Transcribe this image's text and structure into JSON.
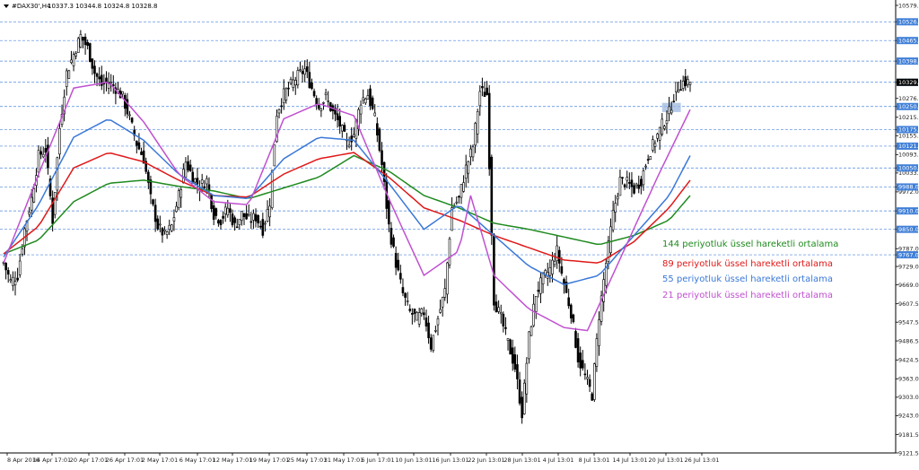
{
  "window": {
    "symbol_title": "#DAX30',H4",
    "ohlc": "10337.3 10344.8 10324.8 10328.8",
    "menu_icon": "triangle-down-icon"
  },
  "chart_data": {
    "type": "candlestick",
    "grid": false,
    "ylim": [
      9121.5,
      10579.5
    ],
    "y_ticks": [
      "10579.5",
      "10526.0",
      "10465.0",
      "10398.0",
      "10329.0",
      "10276.5",
      "10250.0",
      "10215.0",
      "10175.0",
      "10155.0",
      "10121.0",
      "10093.5",
      "10050.0",
      "10033.5",
      "9988.0",
      "9972.0",
      "9910.0",
      "9850.0",
      "9787.0",
      "9767.0",
      "9729.0",
      "9669.0",
      "9607.5",
      "9547.5",
      "9486.5",
      "9424.5",
      "9363.0",
      "9303.0",
      "9243.0",
      "9181.5",
      "9121.5"
    ],
    "x_ticks": [
      "8 Apr 2016",
      "14 Apr 17:01",
      "20 Apr 17:01",
      "26 Apr 17:01",
      "2 May 17:01",
      "6 May 17:01",
      "12 May 17:01",
      "19 May 17:01",
      "25 May 17:01",
      "31 May 17:01",
      "6 Jun 17:01",
      "10 Jun 13:01",
      "16 Jun 13:01",
      "22 Jun 13:01",
      "28 Jun 13:01",
      "4 Jul 13:01",
      "8 Jul 13:01",
      "14 Jul 13:01",
      "20 Jul 13:01",
      "26 Jul 13:01"
    ],
    "current_price": 10329.0,
    "horizontal_lines": [
      {
        "value": 10526.0,
        "label": "10526.0",
        "color": "#2c6fd6"
      },
      {
        "value": 10465.0,
        "label": "10465.0",
        "color": "#2c6fd6"
      },
      {
        "value": 10398.0,
        "label": "10398.0",
        "color": "#2c6fd6"
      },
      {
        "value": 10329.0,
        "label": "10329.0",
        "color": "#2c6fd6"
      },
      {
        "value": 10250.0,
        "label": "10250.0",
        "color": "#2c6fd6"
      },
      {
        "value": 10175.0,
        "label": "10175.0",
        "color": "#2c6fd6"
      },
      {
        "value": 10121.0,
        "label": "10121.0",
        "color": "#2c6fd6"
      },
      {
        "value": 10050.0,
        "label": "10050.0",
        "color": "#2c6fd6"
      },
      {
        "value": 9988.0,
        "label": "9988.0",
        "color": "#2c6fd6"
      },
      {
        "value": 9910.0,
        "label": "9910.0",
        "color": "#2c6fd6"
      },
      {
        "value": 9850.0,
        "label": "9850.0",
        "color": "#2c6fd6"
      },
      {
        "value": 9767.0,
        "label": "9767.0",
        "color": "#2c6fd6"
      }
    ],
    "highlight_box": {
      "x_from": 282,
      "x_to": 290,
      "y_from": 10232,
      "y_to": 10262,
      "color": "#9cb8e0"
    },
    "close_path": [
      [
        0,
        9740
      ],
      [
        3,
        9680
      ],
      [
        6,
        9700
      ],
      [
        9,
        9850
      ],
      [
        12,
        9950
      ],
      [
        15,
        10090
      ],
      [
        18,
        10110
      ],
      [
        21,
        9880
      ],
      [
        24,
        10180
      ],
      [
        27,
        10360
      ],
      [
        30,
        10420
      ],
      [
        33,
        10480
      ],
      [
        36,
        10440
      ],
      [
        39,
        10360
      ],
      [
        42,
        10320
      ],
      [
        45,
        10330
      ],
      [
        48,
        10310
      ],
      [
        51,
        10280
      ],
      [
        54,
        10210
      ],
      [
        57,
        10130
      ],
      [
        60,
        10080
      ],
      [
        63,
        9950
      ],
      [
        66,
        9860
      ],
      [
        69,
        9830
      ],
      [
        72,
        9860
      ],
      [
        75,
        9960
      ],
      [
        78,
        10070
      ],
      [
        81,
        10020
      ],
      [
        84,
        9990
      ],
      [
        87,
        10010
      ],
      [
        90,
        9900
      ],
      [
        93,
        9880
      ],
      [
        96,
        9920
      ],
      [
        99,
        9860
      ],
      [
        102,
        9900
      ],
      [
        105,
        9880
      ],
      [
        108,
        9890
      ],
      [
        111,
        9850
      ],
      [
        114,
        9940
      ],
      [
        117,
        10230
      ],
      [
        120,
        10290
      ],
      [
        123,
        10320
      ],
      [
        126,
        10350
      ],
      [
        129,
        10370
      ],
      [
        132,
        10310
      ],
      [
        135,
        10250
      ],
      [
        138,
        10280
      ],
      [
        141,
        10230
      ],
      [
        144,
        10190
      ],
      [
        147,
        10130
      ],
      [
        150,
        10160
      ],
      [
        153,
        10270
      ],
      [
        156,
        10290
      ],
      [
        159,
        10210
      ],
      [
        162,
        10060
      ],
      [
        165,
        9860
      ],
      [
        168,
        9740
      ],
      [
        171,
        9640
      ],
      [
        174,
        9580
      ],
      [
        177,
        9560
      ],
      [
        180,
        9580
      ],
      [
        183,
        9470
      ],
      [
        186,
        9560
      ],
      [
        189,
        9650
      ],
      [
        192,
        9920
      ],
      [
        195,
        9950
      ],
      [
        198,
        10050
      ],
      [
        201,
        10120
      ],
      [
        204,
        10300
      ],
      [
        207,
        10290
      ],
      [
        210,
        9620
      ],
      [
        213,
        9560
      ],
      [
        216,
        9480
      ],
      [
        219,
        9400
      ],
      [
        222,
        9250
      ],
      [
        225,
        9500
      ],
      [
        228,
        9640
      ],
      [
        231,
        9690
      ],
      [
        234,
        9720
      ],
      [
        237,
        9780
      ],
      [
        240,
        9670
      ],
      [
        243,
        9580
      ],
      [
        246,
        9430
      ],
      [
        249,
        9370
      ],
      [
        252,
        9310
      ],
      [
        255,
        9570
      ],
      [
        258,
        9740
      ],
      [
        261,
        9900
      ],
      [
        264,
        10010
      ],
      [
        267,
        10000
      ],
      [
        270,
        9980
      ],
      [
        273,
        10010
      ],
      [
        276,
        10090
      ],
      [
        279,
        10140
      ],
      [
        282,
        10190
      ],
      [
        285,
        10230
      ],
      [
        288,
        10310
      ],
      [
        291,
        10330
      ],
      [
        294,
        10329
      ]
    ],
    "series": [
      {
        "name": "144 periyotluk üssel hareketli ortalama",
        "color": "#1f8a1f",
        "values": [
          [
            0,
            9770
          ],
          [
            15,
            9815
          ],
          [
            30,
            9940
          ],
          [
            45,
            10000
          ],
          [
            60,
            10010
          ],
          [
            75,
            9990
          ],
          [
            90,
            9975
          ],
          [
            105,
            9950
          ],
          [
            120,
            9985
          ],
          [
            135,
            10020
          ],
          [
            150,
            10090
          ],
          [
            165,
            10040
          ],
          [
            180,
            9960
          ],
          [
            195,
            9920
          ],
          [
            210,
            9870
          ],
          [
            225,
            9850
          ],
          [
            240,
            9825
          ],
          [
            255,
            9800
          ],
          [
            270,
            9830
          ],
          [
            285,
            9880
          ],
          [
            294,
            9960
          ]
        ]
      },
      {
        "name": "89 periyotluk üssel hareketli ortalama",
        "color": "#e01818",
        "values": [
          [
            0,
            9770
          ],
          [
            15,
            9860
          ],
          [
            30,
            10050
          ],
          [
            45,
            10100
          ],
          [
            60,
            10070
          ],
          [
            75,
            10010
          ],
          [
            90,
            9960
          ],
          [
            105,
            9955
          ],
          [
            120,
            10030
          ],
          [
            135,
            10080
          ],
          [
            150,
            10100
          ],
          [
            165,
            10020
          ],
          [
            180,
            9920
          ],
          [
            195,
            9880
          ],
          [
            210,
            9830
          ],
          [
            225,
            9790
          ],
          [
            240,
            9750
          ],
          [
            255,
            9740
          ],
          [
            270,
            9810
          ],
          [
            285,
            9920
          ],
          [
            294,
            10010
          ]
        ]
      },
      {
        "name": "55 periyotluk üssel hareketli ortalama",
        "color": "#3a78d8",
        "values": [
          [
            0,
            9760
          ],
          [
            15,
            9930
          ],
          [
            30,
            10150
          ],
          [
            45,
            10210
          ],
          [
            60,
            10140
          ],
          [
            75,
            10030
          ],
          [
            90,
            9960
          ],
          [
            105,
            9950
          ],
          [
            120,
            10080
          ],
          [
            135,
            10150
          ],
          [
            150,
            10140
          ],
          [
            165,
            10000
          ],
          [
            180,
            9850
          ],
          [
            195,
            9930
          ],
          [
            210,
            9830
          ],
          [
            225,
            9730
          ],
          [
            240,
            9670
          ],
          [
            255,
            9700
          ],
          [
            270,
            9830
          ],
          [
            285,
            9960
          ],
          [
            294,
            10090
          ]
        ]
      },
      {
        "name": "21 periyotluk üssel hareketli ortalama",
        "color": "#c050d0",
        "values": [
          [
            0,
            9740
          ],
          [
            15,
            10030
          ],
          [
            30,
            10310
          ],
          [
            45,
            10330
          ],
          [
            60,
            10200
          ],
          [
            75,
            10030
          ],
          [
            90,
            9940
          ],
          [
            105,
            9930
          ],
          [
            120,
            10210
          ],
          [
            135,
            10260
          ],
          [
            150,
            10220
          ],
          [
            165,
            9950
          ],
          [
            180,
            9700
          ],
          [
            195,
            9780
          ],
          [
            200,
            9960
          ],
          [
            210,
            9700
          ],
          [
            225,
            9590
          ],
          [
            240,
            9530
          ],
          [
            250,
            9520
          ],
          [
            265,
            9770
          ],
          [
            280,
            10020
          ],
          [
            294,
            10240
          ]
        ]
      }
    ]
  },
  "legend": [
    {
      "text": "144 periyotluk üssel hareketli ortalama",
      "color": "#1f8a1f"
    },
    {
      "text": "89 periyotluk üssel hareketli ortalama",
      "color": "#e01818"
    },
    {
      "text": "55 periyotluk üssel hareketli ortalama",
      "color": "#3a78d8"
    },
    {
      "text": "21 periyotluk üssel hareketli ortalama",
      "color": "#c050d0"
    }
  ]
}
